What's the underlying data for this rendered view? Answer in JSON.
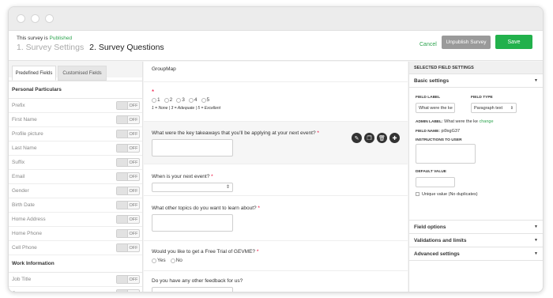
{
  "header": {
    "publish_prefix": "This survey is ",
    "publish_status": "Published",
    "step1": "1. Survey Settings",
    "step2": "2. Survey Questions",
    "cancel": "Cancel",
    "unpublish": "Unpublish Survey",
    "save": "Save"
  },
  "left": {
    "tabs": [
      "Predefined Fields",
      "Customised Fields"
    ],
    "sections": [
      {
        "title": "Personal Particulars",
        "fields": [
          "Prefix",
          "First Name",
          "Profile picture",
          "Last Name",
          "Suffix",
          "Email",
          "Gender",
          "Birth Date",
          "Home Address",
          "Home Phone",
          "Cell Phone"
        ]
      },
      {
        "title": "Work Information",
        "fields": [
          "Job Title",
          "Company"
        ]
      }
    ],
    "toggle_label": "OFF"
  },
  "center": {
    "group_title": "GroupMap",
    "rating": {
      "required_mark": "*",
      "options": [
        "1",
        "2",
        "3",
        "4",
        "5"
      ],
      "note": "1 = None | 3 = Adequate | 5 = Excellent"
    },
    "questions": [
      {
        "text": "What were the key takeaways that you'll be applying at your next event?",
        "required": true
      },
      {
        "text": "When is your next event?",
        "required": true
      },
      {
        "text": "What other topics do you want to learn about?",
        "required": true
      },
      {
        "text": "Would you like to get a Free Trial of GEVME?",
        "required": true,
        "options": [
          "Yes",
          "No"
        ]
      },
      {
        "text": "Do you have any other feedback for us?",
        "required": false
      }
    ],
    "required_mark": "*",
    "select_arrow": "⇕"
  },
  "right": {
    "panel_title": "SELECTED FIELD SETTINGS",
    "basic_settings": "Basic settings",
    "field_label_title": "FIELD LABEL",
    "field_label_value": "What were the ke",
    "field_type_title": "FIELD TYPE",
    "field_type_value": "Paragraph text",
    "admin_label_title": "ADMIN LABEL:",
    "admin_label_value": "What were the ke",
    "change": "change",
    "field_name_title": "FIELD NAME:",
    "field_name_value": "pi9sgG37",
    "instructions_title": "INSTRUCTIONS TO USER",
    "default_value_title": "DEFAULT VALUE",
    "unique_value": "Unique value (No duplicates)",
    "sections": [
      "Field options",
      "Validations and limits",
      "Advanced settings"
    ]
  }
}
